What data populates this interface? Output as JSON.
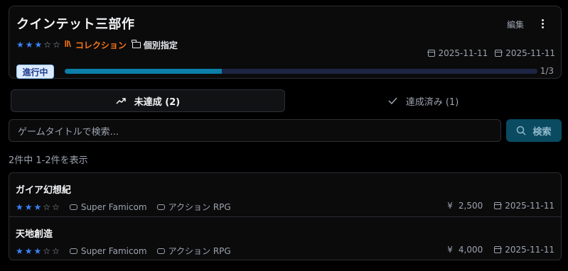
{
  "collection": {
    "title": "クインテット三部作",
    "edit_label": "編集",
    "rating": 3,
    "rating_max": 5,
    "collection_label": "コレクション",
    "tag_label": "個別指定",
    "created_date": "2025-11-11",
    "updated_date": "2025-11-11",
    "status": "進行中",
    "progress_fraction": 0.333,
    "progress_text": "1/3"
  },
  "tabs": [
    {
      "label": "未達成 (2)",
      "icon": "trending-up-icon",
      "active": true
    },
    {
      "label": "達成済み (1)",
      "icon": "check-icon",
      "active": false
    }
  ],
  "search": {
    "placeholder": "ゲームタイトルで検索...",
    "button_label": "検索"
  },
  "result_count": "2件中 1-2件を表示",
  "games": [
    {
      "title": "ガイア幻想紀",
      "rating": 3,
      "platform": "Super Famicom",
      "genre": "アクション RPG",
      "currency": "¥",
      "price": "2,500",
      "date": "2025-11-11"
    },
    {
      "title": "天地創造",
      "rating": 3,
      "platform": "Super Famicom",
      "genre": "アクション RPG",
      "currency": "¥",
      "price": "4,000",
      "date": "2025-11-11"
    }
  ],
  "colors": {
    "accent": "#3b82f6",
    "collection": "#f97316",
    "progress": "#0b7fa8",
    "search_button": "#0a4b61"
  }
}
